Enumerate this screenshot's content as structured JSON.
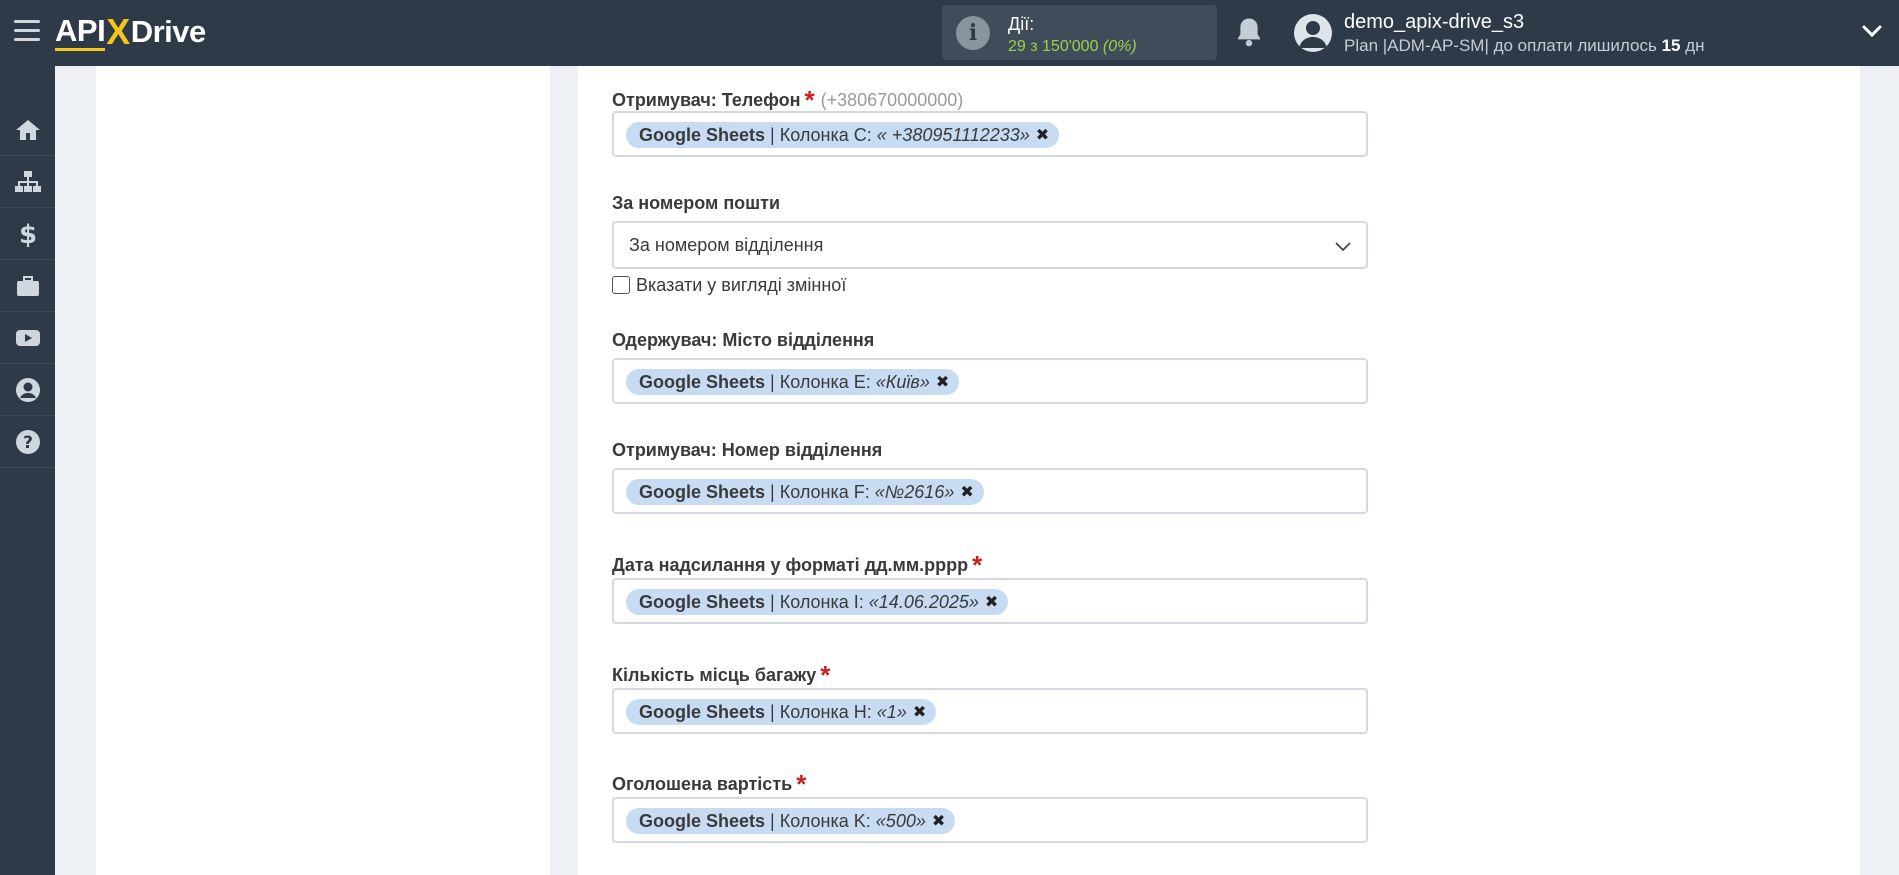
{
  "header": {
    "logo": {
      "part1": "API",
      "part2": "X",
      "part3": "Drive"
    },
    "actions": {
      "label": "Дії:",
      "count": "29 з 150'000",
      "percent": "(0%)"
    },
    "user": {
      "name": "demo_apix-drive_s3",
      "plan_prefix": "Plan |ADM-AP-SM| до оплати лишилось",
      "days": "15",
      "days_unit": "дн"
    }
  },
  "sidebar": {
    "items": [
      {
        "icon": "home-icon"
      },
      {
        "icon": "sitemap-icon"
      },
      {
        "icon": "dollar-icon"
      },
      {
        "icon": "briefcase-icon"
      },
      {
        "icon": "youtube-icon"
      },
      {
        "icon": "user-circle-icon"
      },
      {
        "icon": "question-icon"
      }
    ]
  },
  "form": {
    "phone": {
      "label": "Отримувач: Телефон",
      "hint": "(+380670000000)",
      "tag_source": "Google Sheets",
      "tag_column": "| Колонка C:",
      "tag_value": "« +380951112233»"
    },
    "post_number": {
      "label": "За номером пошти",
      "select_value": "За номером відділення",
      "checkbox_label": "Вказати у вигляді змінної"
    },
    "city": {
      "label": "Одержувач: Місто відділення",
      "tag_source": "Google Sheets",
      "tag_column": "| Колонка E:",
      "tag_value": "«Київ»"
    },
    "branch": {
      "label": "Отримувач: Номер відділення",
      "tag_source": "Google Sheets",
      "tag_column": "| Колонка F:",
      "tag_value": "«№2616»"
    },
    "date": {
      "label": "Дата надсилання у форматі дд.мм.рррр",
      "tag_source": "Google Sheets",
      "tag_column": "| Колонка I:",
      "tag_value": "«14.06.2025»"
    },
    "places": {
      "label": "Кількість місць багажу",
      "tag_source": "Google Sheets",
      "tag_column": "| Колонка H:",
      "tag_value": "«1»"
    },
    "declared": {
      "label": "Оголошена вартість",
      "tag_source": "Google Sheets",
      "tag_column": "| Колонка K:",
      "tag_value": "«500»"
    },
    "required_mark": "*",
    "remove_glyph": "✖"
  },
  "colors": {
    "topbar": "#2e3a48",
    "accent_yellow": "#f5c518",
    "count_green": "#9bd14a",
    "tag_bg": "#c7dcf3",
    "required_red": "#cc1f1f"
  }
}
